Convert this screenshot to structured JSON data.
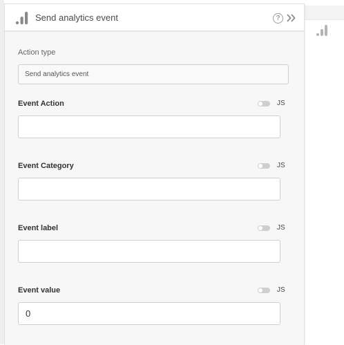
{
  "panel": {
    "title": "Send analytics event",
    "help_glyph": "?",
    "icons": {
      "header": "analytics-bars-icon",
      "help": "help-circle-icon",
      "collapse": "double-chevron-right-icon"
    }
  },
  "action_type": {
    "label": "Action type",
    "selected": "Send analytics event"
  },
  "fields": [
    {
      "label": "Event Action",
      "js_label": "JS",
      "js_enabled": false,
      "value": ""
    },
    {
      "label": "Event Category",
      "js_label": "JS",
      "js_enabled": false,
      "value": ""
    },
    {
      "label": "Event label",
      "js_label": "JS",
      "js_enabled": false,
      "value": ""
    },
    {
      "label": "Event value",
      "js_label": "JS",
      "js_enabled": false,
      "value": "0"
    }
  ],
  "colors": {
    "panel_bg": "#f7f7f7",
    "border": "#cfcfcf",
    "icon": "#8a8a8a"
  }
}
